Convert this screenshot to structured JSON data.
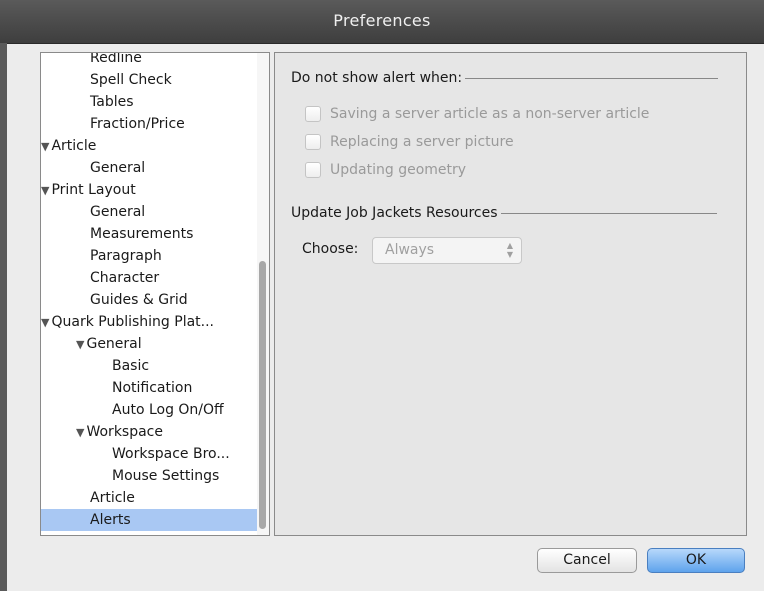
{
  "window": {
    "title": "Preferences"
  },
  "sidebar": {
    "items": [
      {
        "label": "Redline",
        "level": 2,
        "expanded": null
      },
      {
        "label": "Spell Check",
        "level": 2,
        "expanded": null
      },
      {
        "label": "Tables",
        "level": 2,
        "expanded": null
      },
      {
        "label": "Fraction/Price",
        "level": 2,
        "expanded": null
      },
      {
        "label": "Article",
        "level": 1,
        "expanded": true
      },
      {
        "label": "General",
        "level": 2,
        "expanded": null
      },
      {
        "label": "Print Layout",
        "level": 1,
        "expanded": true
      },
      {
        "label": "General",
        "level": 2,
        "expanded": null
      },
      {
        "label": "Measurements",
        "level": 2,
        "expanded": null
      },
      {
        "label": "Paragraph",
        "level": 2,
        "expanded": null
      },
      {
        "label": "Character",
        "level": 2,
        "expanded": null
      },
      {
        "label": "Guides & Grid",
        "level": 2,
        "expanded": null
      },
      {
        "label": "Quark Publishing Plat...",
        "level": 1,
        "expanded": true
      },
      {
        "label": "General",
        "level": 2,
        "expanded": true
      },
      {
        "label": "Basic",
        "level": 3,
        "expanded": null
      },
      {
        "label": "Notification",
        "level": 3,
        "expanded": null
      },
      {
        "label": "Auto Log On/Off",
        "level": 3,
        "expanded": null
      },
      {
        "label": "Workspace",
        "level": 2,
        "expanded": true
      },
      {
        "label": "Workspace Bro...",
        "level": 3,
        "expanded": null
      },
      {
        "label": "Mouse Settings",
        "level": 3,
        "expanded": null
      },
      {
        "label": "Article",
        "level": 2,
        "expanded": null
      },
      {
        "label": "Alerts",
        "level": 2,
        "expanded": null,
        "selected": true
      }
    ],
    "expand_icon": "disclosure-triangle-down"
  },
  "alerts": {
    "section_title": "Do not show alert when:",
    "checkboxes": [
      {
        "label": "Saving a server article as a non-server article",
        "checked": false,
        "enabled": false
      },
      {
        "label": "Replacing a server picture",
        "checked": false,
        "enabled": false
      },
      {
        "label": "Updating geometry",
        "checked": false,
        "enabled": false
      }
    ]
  },
  "job_jackets": {
    "section_title": "Update Job Jackets Resources",
    "choose_label": "Choose:",
    "choose_value": "Always"
  },
  "buttons": {
    "cancel": "Cancel",
    "ok": "OK"
  },
  "colors": {
    "selection": "#a9c8f3",
    "default_button": "#5ea3ec",
    "titlebar": "#4a4a4a"
  }
}
